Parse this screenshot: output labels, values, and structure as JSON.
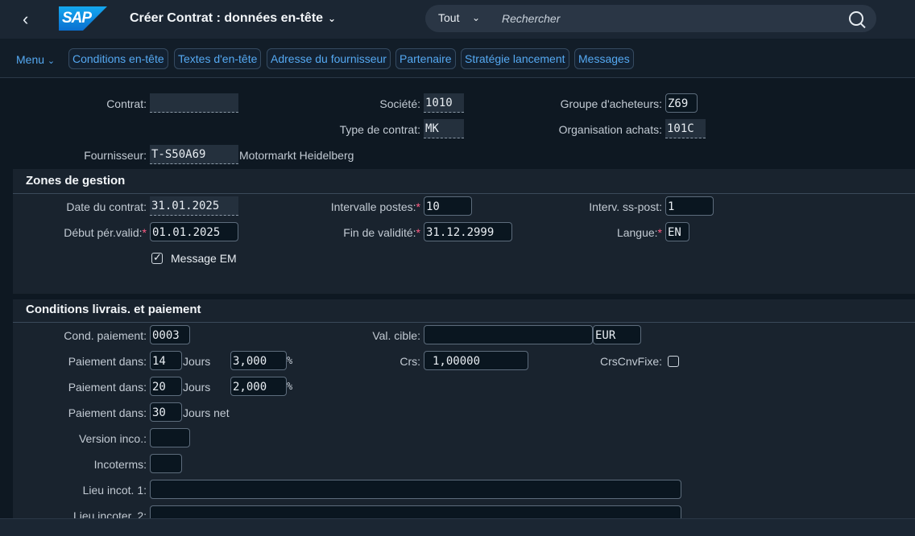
{
  "shell": {
    "logo_text": "SAP",
    "title": "Créer Contrat : données en-tête",
    "search_scope": "Tout",
    "search_placeholder": "Rechercher"
  },
  "toolbar": {
    "menu": "Menu",
    "buttons": [
      "Conditions en-tête",
      "Textes d'en-tête",
      "Adresse du fournisseur",
      "Partenaire",
      "Stratégie lancement",
      "Messages"
    ]
  },
  "header": {
    "contrat_label": "Contrat:",
    "contrat_value": "",
    "societe_label": "Société:",
    "societe_value": "1010",
    "groupe_label": "Groupe d'acheteurs:",
    "groupe_value": "Z69",
    "type_label": "Type de contrat:",
    "type_value": "MK",
    "orga_label": "Organisation achats:",
    "orga_value": "101C",
    "fournisseur_label": "Fournisseur:",
    "fournisseur_value": "T-S50A69",
    "fournisseur_name": "Motormarkt Heidelberg"
  },
  "gestion": {
    "title": "Zones de gestion",
    "date_label": "Date du contrat:",
    "date_value": "31.01.2025",
    "intervalle_label": "Intervalle postes:",
    "intervalle_value": "10",
    "ssposte_label": "Interv. ss-post:",
    "ssposte_value": "1",
    "debut_label": "Début pér.valid:",
    "debut_value": "01.01.2025",
    "fin_label": "Fin de validité:",
    "fin_value": "31.12.2999",
    "langue_label": "Langue:",
    "langue_value": "EN",
    "message_em_label": "Message EM",
    "message_em_checked": true,
    "required_mark": "*"
  },
  "livraison": {
    "title": "Conditions livrais. et paiement",
    "cond_label": "Cond. paiement:",
    "cond_value": "0003",
    "valcible_label": "Val. cible:",
    "valcible_value": "",
    "currency_value": "EUR",
    "paiement_label": "Paiement dans:",
    "p1_days": "14",
    "p1_unit": "Jours",
    "p1_pct": "3,000",
    "pct_sign": "%",
    "crs_label": "Crs:",
    "crs_value": "1,00000",
    "crscnv_label": "CrsCnvFixe:",
    "crscnv_checked": false,
    "p2_days": "20",
    "p2_unit": "Jours",
    "p2_pct": "2,000",
    "p3_days": "30",
    "p3_unit": "Jours net",
    "version_label": "Version inco.:",
    "version_value": "",
    "incoterms_label": "Incoterms:",
    "incoterms_value": "",
    "lieu1_label": "Lieu incot. 1:",
    "lieu1_value": "",
    "lieu2_label": "Lieu incoter. 2:",
    "lieu2_value": ""
  }
}
